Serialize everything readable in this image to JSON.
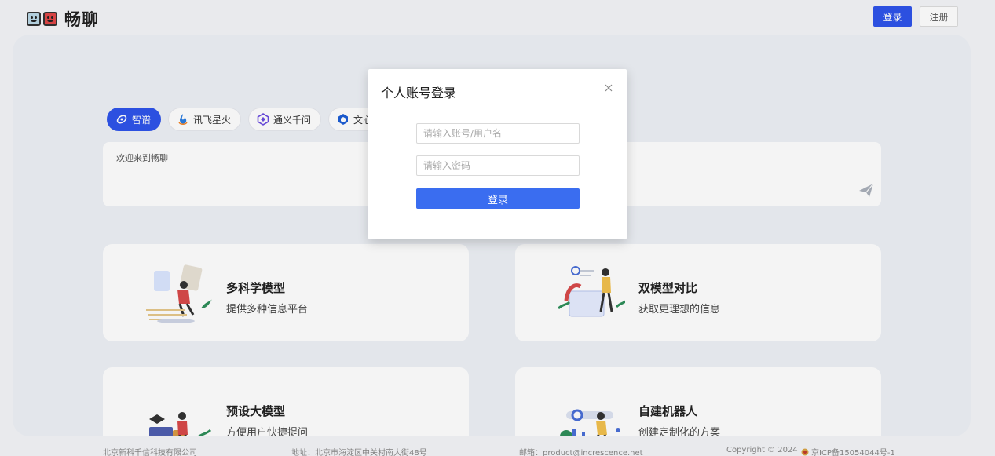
{
  "header": {
    "app_name": "畅聊",
    "login_label": "登录",
    "register_label": "注册"
  },
  "models": [
    {
      "label": "智谱",
      "icon": "zhipu-icon",
      "active": true
    },
    {
      "label": "讯飞星火",
      "icon": "xunfei-icon",
      "active": false
    },
    {
      "label": "通义千问",
      "icon": "tongyi-icon",
      "active": false
    },
    {
      "label": "文心",
      "icon": "wenxin-icon",
      "active": false
    }
  ],
  "chat": {
    "welcome_text": "欢迎来到畅聊",
    "send_icon": "send-icon"
  },
  "cards": [
    {
      "title": "多科学模型",
      "desc": "提供多种信息平台"
    },
    {
      "title": "双模型对比",
      "desc": "获取更理想的信息"
    },
    {
      "title": "预设大模型",
      "desc": "方便用户快捷提问"
    },
    {
      "title": "自建机器人",
      "desc": "创建定制化的方案"
    }
  ],
  "footer": {
    "company": "北京新科千信科技有限公司",
    "address": "地址：北京市海淀区中关村南大街48号",
    "email": "邮箱：product@increscence.net",
    "copyright": "Copyright © 2024",
    "icp": "京ICP备15054044号-1"
  },
  "modal": {
    "title": "个人账号登录",
    "username_placeholder": "请输入账号/用户名",
    "password_placeholder": "请输入密码",
    "submit_label": "登录"
  },
  "colors": {
    "primary": "#2f54eb",
    "submit": "#3a6df0",
    "panel": "#eef1f6"
  }
}
